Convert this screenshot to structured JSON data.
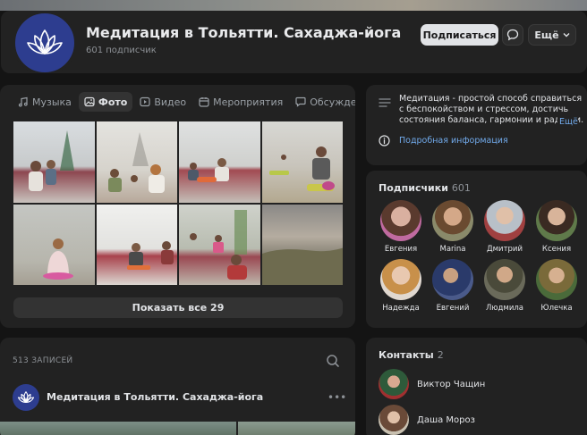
{
  "header": {
    "title": "Медитация в Тольятти. Сахаджа-йога",
    "subscribers": "601 подписчик",
    "subscribe_label": "Подписаться",
    "more_label": "Ещё"
  },
  "media": {
    "tabs": [
      {
        "label": "Музыка",
        "icon": "music-icon"
      },
      {
        "label": "Фото",
        "icon": "photo-icon",
        "active": true
      },
      {
        "label": "Видео",
        "icon": "video-icon"
      },
      {
        "label": "Мероприятия",
        "icon": "calendar-icon"
      },
      {
        "label": "Обсуждения",
        "icon": "discussion-icon"
      }
    ],
    "show_all_label": "Показать все 29"
  },
  "about": {
    "text": "Медитация - простой способ справиться с беспокойством и стрессом, достичь состояния баланса, гармонии и радости.",
    "more_label": "Ещё",
    "info_link": "Подробная информация"
  },
  "subscribers_block": {
    "title": "Подписчики",
    "count": "601",
    "people": [
      {
        "name": "Евгения"
      },
      {
        "name": "Marina"
      },
      {
        "name": "Дмитрий"
      },
      {
        "name": "Ксения"
      },
      {
        "name": "Надежда"
      },
      {
        "name": "Евгений"
      },
      {
        "name": "Людмила"
      },
      {
        "name": "Юлечка"
      }
    ]
  },
  "posts": {
    "count_label": "513 ЗАПИСЕЙ",
    "author": "Медитация в Тольятти. Сахаджа-йога"
  },
  "contacts": {
    "title": "Контакты",
    "count": "2",
    "people": [
      {
        "name": "Виктор Чащин"
      },
      {
        "name": "Даша Мороз"
      }
    ]
  },
  "colors": {
    "background": "#141414",
    "card": "#222222",
    "link": "#71aaeb",
    "avatar_bg": "#2d3d8f"
  }
}
